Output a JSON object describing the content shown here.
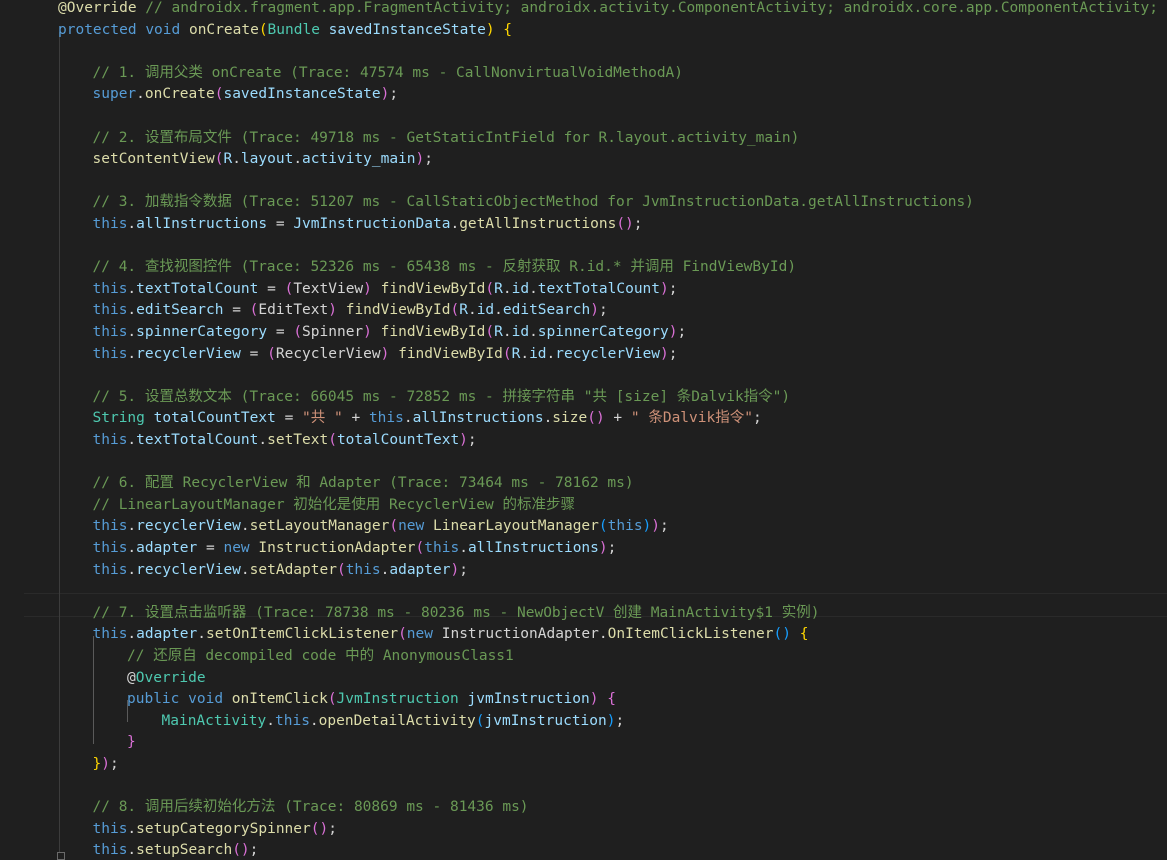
{
  "colors": {
    "background": "#1f1f1f",
    "comment": "#6a9955",
    "keyword": "#569cd6",
    "function": "#dcdcaa",
    "type": "#4ec9b0",
    "variable": "#9cdcfe",
    "string": "#ce9178",
    "plain": "#d4d4d4",
    "bracket_level1": "#ffd700",
    "bracket_level2": "#da70d6",
    "bracket_level3": "#179fff"
  },
  "code_lines": [
    {
      "indent": 0,
      "tokens": [
        [
          "annot",
          "@Override"
        ],
        [
          "comment",
          " // androidx.fragment.app.FragmentActivity; androidx.activity.ComponentActivity; androidx.core.app.ComponentActivity; a"
        ]
      ]
    },
    {
      "indent": 0,
      "tokens": [
        [
          "keyword",
          "protected"
        ],
        [
          "plain",
          " "
        ],
        [
          "keyword",
          "void"
        ],
        [
          "plain",
          " "
        ],
        [
          "func",
          "onCreate"
        ],
        [
          "brace1",
          "("
        ],
        [
          "type",
          "Bundle"
        ],
        [
          "plain",
          " "
        ],
        [
          "var",
          "savedInstanceState"
        ],
        [
          "brace1",
          ")"
        ],
        [
          "plain",
          " "
        ],
        [
          "brace1",
          "{"
        ]
      ]
    },
    {
      "indent": 0,
      "tokens": []
    },
    {
      "indent": 1,
      "tokens": [
        [
          "comment",
          "// 1. 调用父类 onCreate (Trace: 47574 ms - CallNonvirtualVoidMethodA)"
        ]
      ]
    },
    {
      "indent": 1,
      "tokens": [
        [
          "keyword",
          "super"
        ],
        [
          "plain",
          "."
        ],
        [
          "func",
          "onCreate"
        ],
        [
          "brace2",
          "("
        ],
        [
          "var",
          "savedInstanceState"
        ],
        [
          "brace2",
          ")"
        ],
        [
          "plain",
          ";"
        ]
      ]
    },
    {
      "indent": 0,
      "tokens": []
    },
    {
      "indent": 1,
      "tokens": [
        [
          "comment",
          "// 2. 设置布局文件 (Trace: 49718 ms - GetStaticIntField for R.layout.activity_main)"
        ]
      ]
    },
    {
      "indent": 1,
      "tokens": [
        [
          "func",
          "setContentView"
        ],
        [
          "brace2",
          "("
        ],
        [
          "var",
          "R"
        ],
        [
          "plain",
          "."
        ],
        [
          "var",
          "layout"
        ],
        [
          "plain",
          "."
        ],
        [
          "var",
          "activity_main"
        ],
        [
          "brace2",
          ")"
        ],
        [
          "plain",
          ";"
        ]
      ]
    },
    {
      "indent": 0,
      "tokens": []
    },
    {
      "indent": 1,
      "tokens": [
        [
          "comment",
          "// 3. 加载指令数据 (Trace: 51207 ms - CallStaticObjectMethod for JvmInstructionData.getAllInstructions)"
        ]
      ]
    },
    {
      "indent": 1,
      "tokens": [
        [
          "keyword",
          "this"
        ],
        [
          "plain",
          "."
        ],
        [
          "var",
          "allInstructions"
        ],
        [
          "plain",
          " = "
        ],
        [
          "var",
          "JvmInstructionData"
        ],
        [
          "plain",
          "."
        ],
        [
          "func",
          "getAllInstructions"
        ],
        [
          "brace2",
          "()"
        ],
        [
          "plain",
          ";"
        ]
      ]
    },
    {
      "indent": 0,
      "tokens": []
    },
    {
      "indent": 1,
      "tokens": [
        [
          "comment",
          "// 4. 查找视图控件 (Trace: 52326 ms - 65438 ms - 反射获取 R.id.* 并调用 FindViewById)"
        ]
      ]
    },
    {
      "indent": 1,
      "tokens": [
        [
          "keyword",
          "this"
        ],
        [
          "plain",
          "."
        ],
        [
          "var",
          "textTotalCount"
        ],
        [
          "plain",
          " = "
        ],
        [
          "brace2",
          "("
        ],
        [
          "plain",
          "TextView"
        ],
        [
          "brace2",
          ")"
        ],
        [
          "plain",
          " "
        ],
        [
          "func",
          "findViewById"
        ],
        [
          "brace2",
          "("
        ],
        [
          "var",
          "R"
        ],
        [
          "plain",
          "."
        ],
        [
          "var",
          "id"
        ],
        [
          "plain",
          "."
        ],
        [
          "var",
          "textTotalCount"
        ],
        [
          "brace2",
          ")"
        ],
        [
          "plain",
          ";"
        ]
      ]
    },
    {
      "indent": 1,
      "tokens": [
        [
          "keyword",
          "this"
        ],
        [
          "plain",
          "."
        ],
        [
          "var",
          "editSearch"
        ],
        [
          "plain",
          " = "
        ],
        [
          "brace2",
          "("
        ],
        [
          "plain",
          "EditText"
        ],
        [
          "brace2",
          ")"
        ],
        [
          "plain",
          " "
        ],
        [
          "func",
          "findViewById"
        ],
        [
          "brace2",
          "("
        ],
        [
          "var",
          "R"
        ],
        [
          "plain",
          "."
        ],
        [
          "var",
          "id"
        ],
        [
          "plain",
          "."
        ],
        [
          "var",
          "editSearch"
        ],
        [
          "brace2",
          ")"
        ],
        [
          "plain",
          ";"
        ]
      ]
    },
    {
      "indent": 1,
      "tokens": [
        [
          "keyword",
          "this"
        ],
        [
          "plain",
          "."
        ],
        [
          "var",
          "spinnerCategory"
        ],
        [
          "plain",
          " = "
        ],
        [
          "brace2",
          "("
        ],
        [
          "plain",
          "Spinner"
        ],
        [
          "brace2",
          ")"
        ],
        [
          "plain",
          " "
        ],
        [
          "func",
          "findViewById"
        ],
        [
          "brace2",
          "("
        ],
        [
          "var",
          "R"
        ],
        [
          "plain",
          "."
        ],
        [
          "var",
          "id"
        ],
        [
          "plain",
          "."
        ],
        [
          "var",
          "spinnerCategory"
        ],
        [
          "brace2",
          ")"
        ],
        [
          "plain",
          ";"
        ]
      ]
    },
    {
      "indent": 1,
      "tokens": [
        [
          "keyword",
          "this"
        ],
        [
          "plain",
          "."
        ],
        [
          "var",
          "recyclerView"
        ],
        [
          "plain",
          " = "
        ],
        [
          "brace2",
          "("
        ],
        [
          "plain",
          "RecyclerView"
        ],
        [
          "brace2",
          ")"
        ],
        [
          "plain",
          " "
        ],
        [
          "func",
          "findViewById"
        ],
        [
          "brace2",
          "("
        ],
        [
          "var",
          "R"
        ],
        [
          "plain",
          "."
        ],
        [
          "var",
          "id"
        ],
        [
          "plain",
          "."
        ],
        [
          "var",
          "recyclerView"
        ],
        [
          "brace2",
          ")"
        ],
        [
          "plain",
          ";"
        ]
      ]
    },
    {
      "indent": 0,
      "tokens": []
    },
    {
      "indent": 1,
      "tokens": [
        [
          "comment",
          "// 5. 设置总数文本 (Trace: 66045 ms - 72852 ms - 拼接字符串 \"共 [size] 条Dalvik指令\")"
        ]
      ]
    },
    {
      "indent": 1,
      "tokens": [
        [
          "type",
          "String"
        ],
        [
          "plain",
          " "
        ],
        [
          "var",
          "totalCountText"
        ],
        [
          "plain",
          " = "
        ],
        [
          "string",
          "\"共 \""
        ],
        [
          "plain",
          " + "
        ],
        [
          "keyword",
          "this"
        ],
        [
          "plain",
          "."
        ],
        [
          "var",
          "allInstructions"
        ],
        [
          "plain",
          "."
        ],
        [
          "func",
          "size"
        ],
        [
          "brace2",
          "()"
        ],
        [
          "plain",
          " + "
        ],
        [
          "string",
          "\" 条Dalvik指令\""
        ],
        [
          "plain",
          ";"
        ]
      ]
    },
    {
      "indent": 1,
      "tokens": [
        [
          "keyword",
          "this"
        ],
        [
          "plain",
          "."
        ],
        [
          "var",
          "textTotalCount"
        ],
        [
          "plain",
          "."
        ],
        [
          "func",
          "setText"
        ],
        [
          "brace2",
          "("
        ],
        [
          "var",
          "totalCountText"
        ],
        [
          "brace2",
          ")"
        ],
        [
          "plain",
          ";"
        ]
      ]
    },
    {
      "indent": 0,
      "tokens": []
    },
    {
      "indent": 1,
      "tokens": [
        [
          "comment",
          "// 6. 配置 RecyclerView 和 Adapter (Trace: 73464 ms - 78162 ms)"
        ]
      ]
    },
    {
      "indent": 1,
      "tokens": [
        [
          "comment",
          "// LinearLayoutManager 初始化是使用 RecyclerView 的标准步骤"
        ]
      ]
    },
    {
      "indent": 1,
      "tokens": [
        [
          "keyword",
          "this"
        ],
        [
          "plain",
          "."
        ],
        [
          "var",
          "recyclerView"
        ],
        [
          "plain",
          "."
        ],
        [
          "func",
          "setLayoutManager"
        ],
        [
          "brace2",
          "("
        ],
        [
          "keyword",
          "new"
        ],
        [
          "plain",
          " "
        ],
        [
          "func",
          "LinearLayoutManager"
        ],
        [
          "brace3",
          "("
        ],
        [
          "keyword",
          "this"
        ],
        [
          "brace3",
          ")"
        ],
        [
          "brace2",
          ")"
        ],
        [
          "plain",
          ";"
        ]
      ]
    },
    {
      "indent": 1,
      "tokens": [
        [
          "keyword",
          "this"
        ],
        [
          "plain",
          "."
        ],
        [
          "var",
          "adapter"
        ],
        [
          "plain",
          " = "
        ],
        [
          "keyword",
          "new"
        ],
        [
          "plain",
          " "
        ],
        [
          "func",
          "InstructionAdapter"
        ],
        [
          "brace2",
          "("
        ],
        [
          "keyword",
          "this"
        ],
        [
          "plain",
          "."
        ],
        [
          "var",
          "allInstructions"
        ],
        [
          "brace2",
          ")"
        ],
        [
          "plain",
          ";"
        ]
      ]
    },
    {
      "indent": 1,
      "tokens": [
        [
          "keyword",
          "this"
        ],
        [
          "plain",
          "."
        ],
        [
          "var",
          "recyclerView"
        ],
        [
          "plain",
          "."
        ],
        [
          "func",
          "setAdapter"
        ],
        [
          "brace2",
          "("
        ],
        [
          "keyword",
          "this"
        ],
        [
          "plain",
          "."
        ],
        [
          "var",
          "adapter"
        ],
        [
          "brace2",
          ")"
        ],
        [
          "plain",
          ";"
        ]
      ]
    },
    {
      "indent": 0,
      "tokens": []
    },
    {
      "indent": 1,
      "tokens": [
        [
          "comment",
          "// 7. 设置点击监听器 (Trace: 78738 ms - 80236 ms - NewObjectV 创建 MainActivity$1 实例)"
        ]
      ]
    },
    {
      "indent": 1,
      "tokens": [
        [
          "keyword",
          "this"
        ],
        [
          "plain",
          "."
        ],
        [
          "var",
          "adapter"
        ],
        [
          "plain",
          "."
        ],
        [
          "func",
          "setOnItemClickListener"
        ],
        [
          "brace2",
          "("
        ],
        [
          "keyword",
          "new"
        ],
        [
          "plain",
          " "
        ],
        [
          "plain",
          "InstructionAdapter"
        ],
        [
          "plain",
          "."
        ],
        [
          "func",
          "OnItemClickListener"
        ],
        [
          "brace3",
          "()"
        ],
        [
          "plain",
          " "
        ],
        [
          "brace1",
          "{"
        ]
      ]
    },
    {
      "indent": 2,
      "tokens": [
        [
          "comment",
          "// 还原自 decompiled code 中的 AnonymousClass1"
        ]
      ]
    },
    {
      "indent": 2,
      "tokens": [
        [
          "plain",
          "@"
        ],
        [
          "type",
          "Override"
        ]
      ]
    },
    {
      "indent": 2,
      "tokens": [
        [
          "keyword",
          "public"
        ],
        [
          "plain",
          " "
        ],
        [
          "keyword",
          "void"
        ],
        [
          "plain",
          " "
        ],
        [
          "func",
          "onItemClick"
        ],
        [
          "brace2",
          "("
        ],
        [
          "type",
          "JvmInstruction"
        ],
        [
          "plain",
          " "
        ],
        [
          "var",
          "jvmInstruction"
        ],
        [
          "brace2",
          ")"
        ],
        [
          "plain",
          " "
        ],
        [
          "brace2",
          "{"
        ]
      ]
    },
    {
      "indent": 3,
      "tokens": [
        [
          "type",
          "MainActivity"
        ],
        [
          "plain",
          "."
        ],
        [
          "keyword",
          "this"
        ],
        [
          "plain",
          "."
        ],
        [
          "func",
          "openDetailActivity"
        ],
        [
          "brace3",
          "("
        ],
        [
          "var",
          "jvmInstruction"
        ],
        [
          "brace3",
          ")"
        ],
        [
          "plain",
          ";"
        ]
      ]
    },
    {
      "indent": 2,
      "tokens": [
        [
          "brace2",
          "}"
        ]
      ]
    },
    {
      "indent": 1,
      "tokens": [
        [
          "brace1",
          "}"
        ],
        [
          "brace2",
          ")"
        ],
        [
          "plain",
          ";"
        ]
      ]
    },
    {
      "indent": 0,
      "tokens": []
    },
    {
      "indent": 1,
      "tokens": [
        [
          "comment",
          "// 8. 调用后续初始化方法 (Trace: 80869 ms - 81436 ms)"
        ]
      ]
    },
    {
      "indent": 1,
      "tokens": [
        [
          "keyword",
          "this"
        ],
        [
          "plain",
          "."
        ],
        [
          "func",
          "setupCategorySpinner"
        ],
        [
          "brace2",
          "()"
        ],
        [
          "plain",
          ";"
        ]
      ]
    },
    {
      "indent": 1,
      "tokens": [
        [
          "keyword",
          "this"
        ],
        [
          "plain",
          "."
        ],
        [
          "func",
          "setupSearch"
        ],
        [
          "brace2",
          "()"
        ],
        [
          "plain",
          ";"
        ]
      ]
    }
  ]
}
